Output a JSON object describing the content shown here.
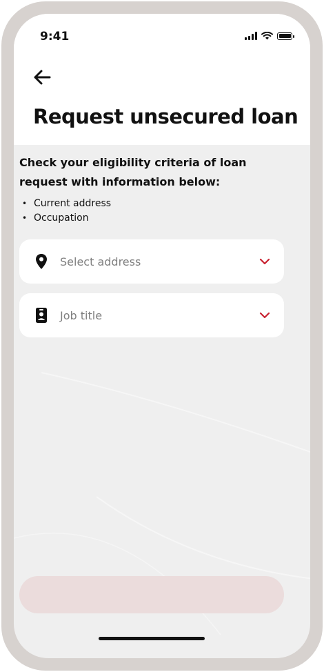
{
  "status_bar": {
    "time": "9:41"
  },
  "header": {
    "title": "Request unsecured loan"
  },
  "intro": {
    "text": "Check your eligibility criteria of loan request with information below:",
    "criteria": [
      "Current address",
      "Occupation"
    ]
  },
  "fields": {
    "address": {
      "placeholder": "Select address",
      "icon": "location-pin-icon"
    },
    "job": {
      "placeholder": "Job title",
      "icon": "id-badge-icon"
    }
  },
  "submit": {
    "label": ""
  },
  "colors": {
    "accent": "#c8202f",
    "disabled_button": "#ebdcdc",
    "background": "#efefef"
  }
}
